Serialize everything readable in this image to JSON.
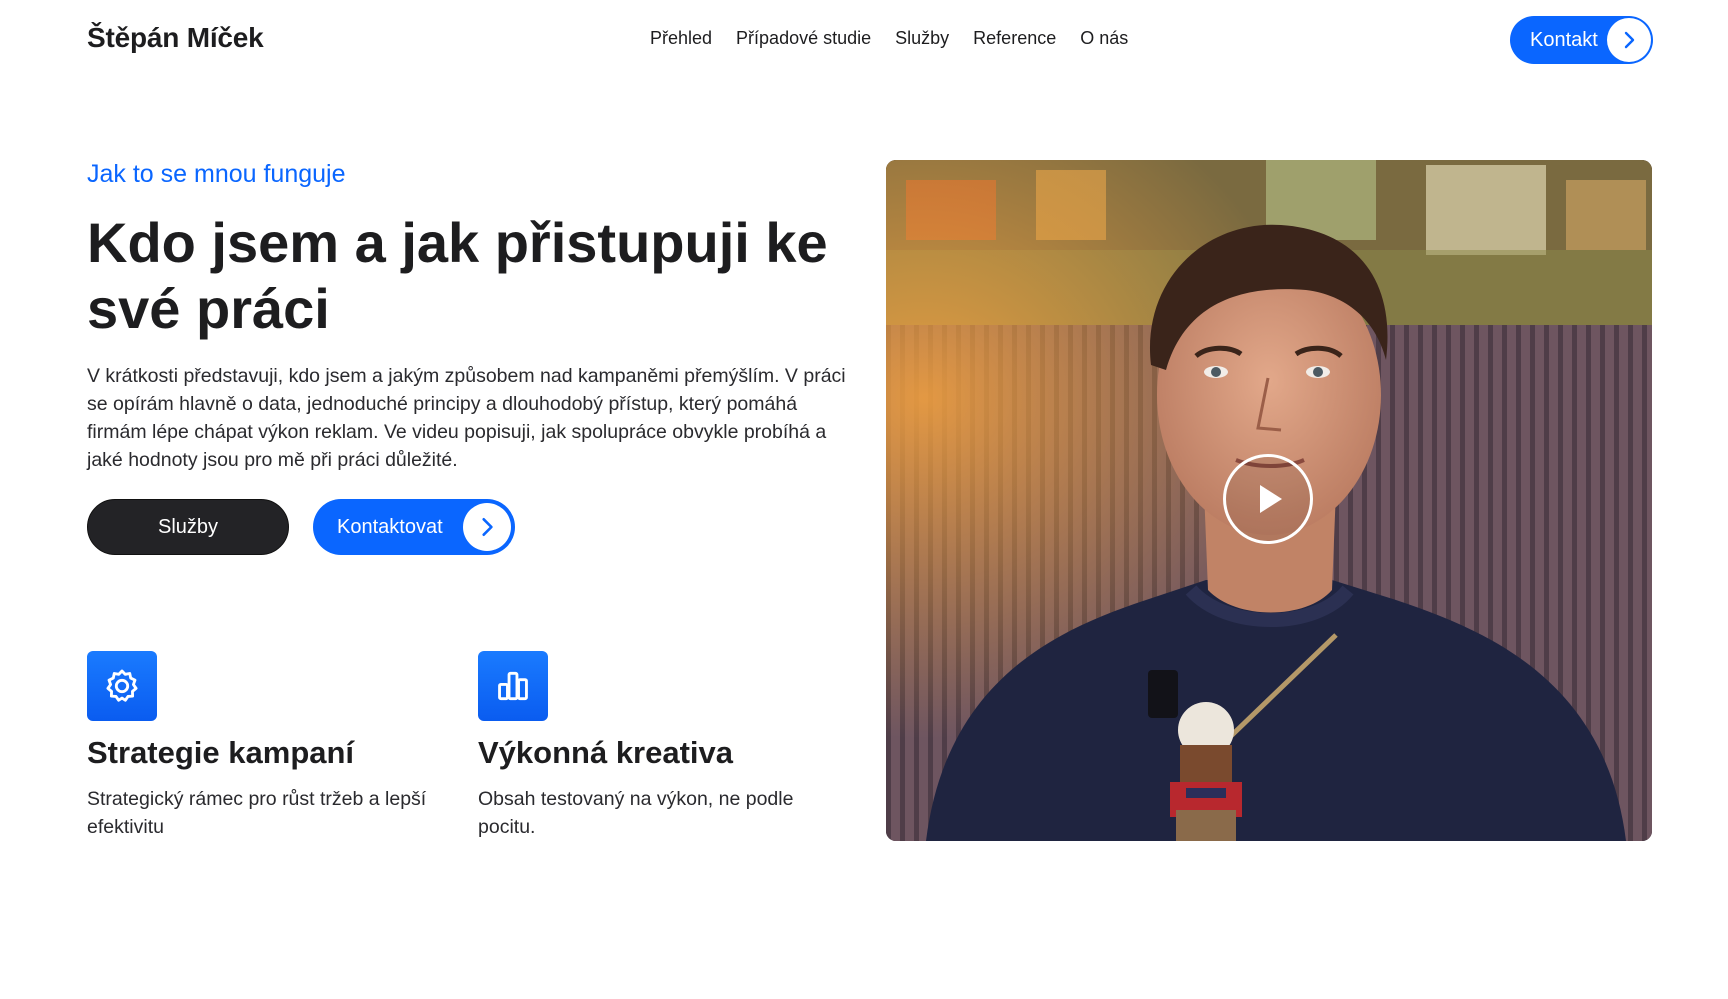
{
  "header": {
    "logo": "Štěpán Míček",
    "nav": [
      "Přehled",
      "Případové studie",
      "Služby",
      "Reference",
      "O nás"
    ],
    "cta_label": "Kontakt"
  },
  "hero": {
    "eyebrow": "Jak to se mnou funguje",
    "title": "Kdo jsem a jak přistupuji ke své práci",
    "lead": "V krátkosti představuji, kdo jsem a jakým způsobem nad kampaněmi přemýšlím. V práci se opírám hlavně o data, jednoduché principy a dlouhodobý přístup, který pomáhá firmám lépe chápat výkon reklam. Ve videu popisuji, jak spolupráce obvykle probíhá a jaké hodnoty jsou pro mě při práci důležité.",
    "primary_button": "Služby",
    "secondary_button": "Kontaktovat"
  },
  "features": [
    {
      "icon": "gear-icon",
      "title": "Strategie kampaní",
      "description": "Strategický rámec pro růst tržeb a lepší efektivitu"
    },
    {
      "icon": "bar-chart-icon",
      "title": "Výkonná kreativa",
      "description": "Obsah testovaný na výkon, ne podle pocitu."
    }
  ],
  "video": {
    "icon": "play-icon"
  },
  "colors": {
    "accent": "#0a66ff",
    "dark_button": "#232326",
    "text": "#1d1d1f"
  }
}
